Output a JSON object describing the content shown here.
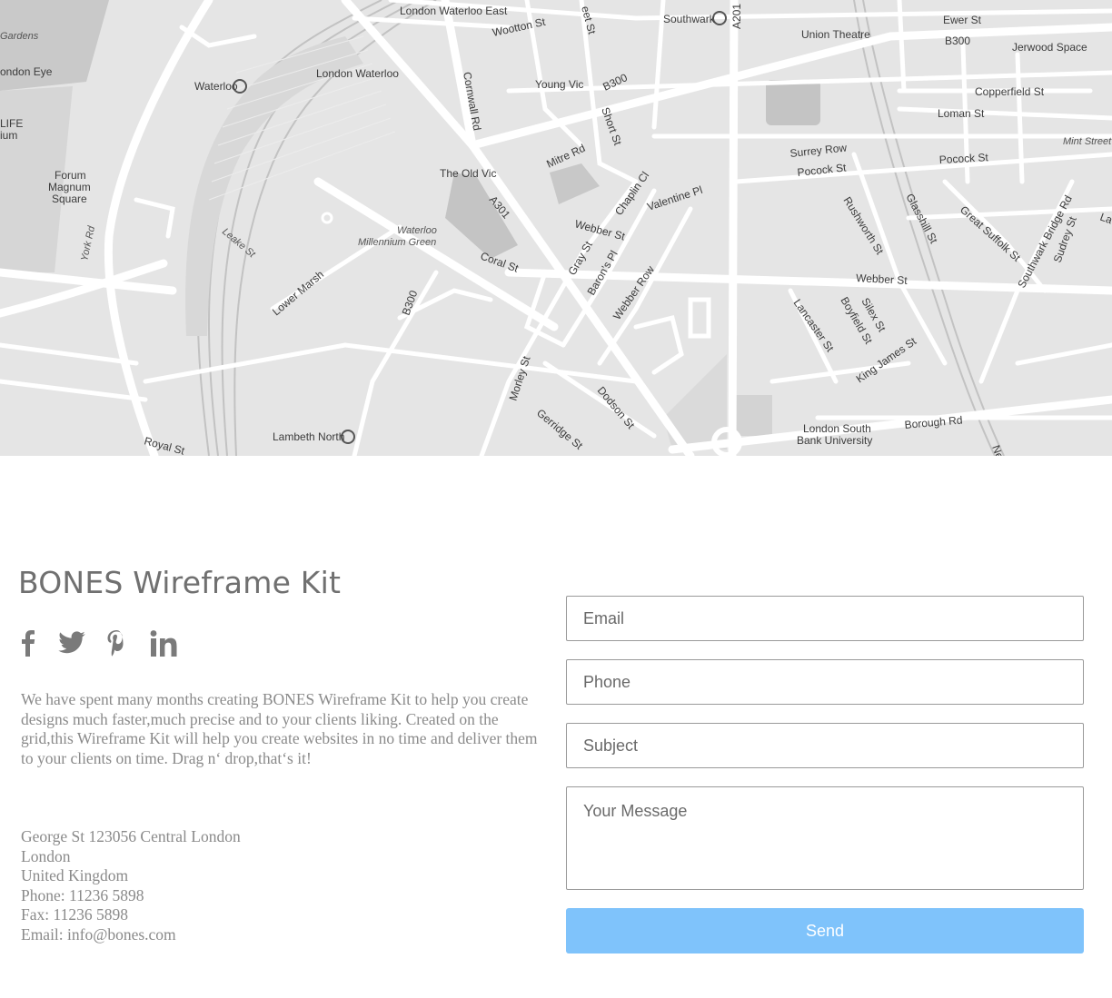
{
  "map": {
    "labels": {
      "london_waterloo_east": "London Waterloo East",
      "wootton_st": "Wootton St",
      "eet_st": "eet St",
      "southwark": "Southwark",
      "a201": "A201",
      "ewer_st": "Ewer St",
      "union_theatre": "Union Theatre",
      "b300_top": "B300",
      "jerwood_space": "Jerwood Space",
      "gardens": "Gardens",
      "london_eye": "ondon Eye",
      "waterloo": "Waterloo",
      "london_waterloo": "London Waterloo",
      "cornwall_rd": "Cornwall Rd",
      "young_vic": "Young Vic",
      "b300_mid": "B300",
      "copperfield_st": "Copperfield St",
      "loman_st": "Loman St",
      "life": "LIFE",
      "ium": "ium",
      "short_st": "Short St",
      "mint_street": "Mint Street",
      "forum": "Forum",
      "magnum": "Magnum",
      "square": "Square",
      "mitre_rd": "Mitre Rd",
      "surrey_row": "Surrey Row",
      "pocock_st_1": "Pocock St",
      "pocock_st_2": "Pocock St",
      "the_old_vic": "The Old Vic",
      "chaplin_cl": "Chaplin Cl",
      "valentine_pl": "Valentine Pl",
      "a301": "A301",
      "rushworth_st": "Rushworth St",
      "glasshill_st": "Glasshill St",
      "great_suffolk_st": "Great Suffolk St",
      "southwark_bridge_rd": "Southwark Bridge Rd",
      "sudrey_st": "Sudrey St",
      "la": "La",
      "waterloo_green_1": "Waterloo",
      "waterloo_green_2": "Millennium Green",
      "webber_st_1": "Webber St",
      "leake_st": "Leake St",
      "york_rd": "York Rd",
      "coral_st": "Coral St",
      "gray_st": "Gray St",
      "barons_pl": "Baron's Pl",
      "webber_st_2": "Webber St",
      "lower_marsh": "Lower Marsh",
      "b300_low": "B300",
      "webber_row": "Webber Row",
      "lancaster_st": "Lancaster St",
      "boyfield_st": "Boyfield St",
      "silex_st": "Silex St",
      "king_james_st": "King James St",
      "morley_st": "Morley St",
      "dodson_st": "Dodson St",
      "gerridge_st": "Gerridge St",
      "lambeth_north": "Lambeth North",
      "royal_st": "Royal St",
      "london_south_1": "London South",
      "london_south_2": "Bank University",
      "borough_rd": "Borough Rd",
      "ne": "Ne"
    }
  },
  "contact": {
    "title": "BONES Wireframe Kit",
    "about": "We have spent many months creating BONES Wireframe Kit to help you create designs much faster,much precise and to your clients liking. Created on the grid,this Wireframe Kit will help you create websites in no time and deliver them to your clients on time. Drag n‘ drop,that‘s it!",
    "address": {
      "street": "George St 123056 Central London",
      "city": "London",
      "country": "United Kingdom",
      "phone": "Phone: 11236 5898",
      "fax": "Fax: 11236 5898",
      "email": "Email: info@bones.com"
    },
    "social": [
      "facebook-icon",
      "twitter-icon",
      "pinterest-icon",
      "linkedin-icon"
    ]
  },
  "form": {
    "email_placeholder": "Email",
    "email_value": "",
    "phone_placeholder": "Phone",
    "phone_value": "",
    "subject_placeholder": "Subject",
    "subject_value": "",
    "message_placeholder": "Your Message",
    "message_value": "",
    "send_label": "Send"
  },
  "colors": {
    "map_background": "#e5e5e5",
    "road": "#ffffff",
    "text_muted": "#8a8a8a",
    "title": "#707070",
    "send_button": "#7fc3fb"
  }
}
